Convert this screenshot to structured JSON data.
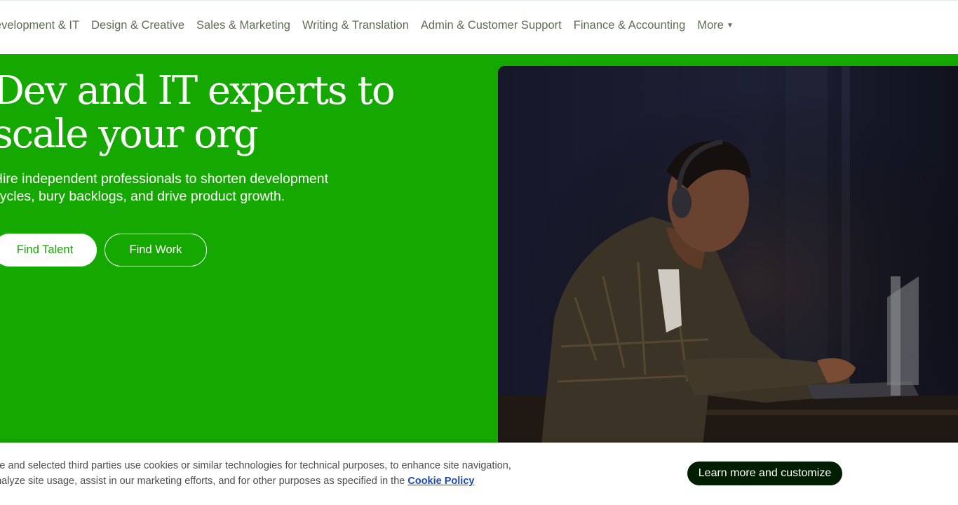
{
  "nav": {
    "items": [
      {
        "label": "Development & IT"
      },
      {
        "label": "Design & Creative"
      },
      {
        "label": "Sales & Marketing"
      },
      {
        "label": "Writing & Translation"
      },
      {
        "label": "Admin & Customer Support"
      },
      {
        "label": "Finance & Accounting"
      },
      {
        "label": "More"
      }
    ]
  },
  "hero": {
    "title": "Dev and IT experts to scale your org",
    "subtitle": "Hire independent professionals to shorten development cycles, bury backlogs, and drive product growth.",
    "find_talent_label": "Find Talent",
    "find_work_label": "Find Work"
  },
  "cookie": {
    "text": "We and selected third parties use cookies or similar technologies for technical purposes, to enhance site navigation, analyze site usage, assist in our marketing efforts, and for other purposes as specified in the",
    "link_label": "Cookie Policy",
    "button_label": "Learn more and customize"
  },
  "colors": {
    "brand_green": "#14a800",
    "dark": "#001e00",
    "nav_text": "#5e6d55",
    "link": "#1c47b5"
  }
}
